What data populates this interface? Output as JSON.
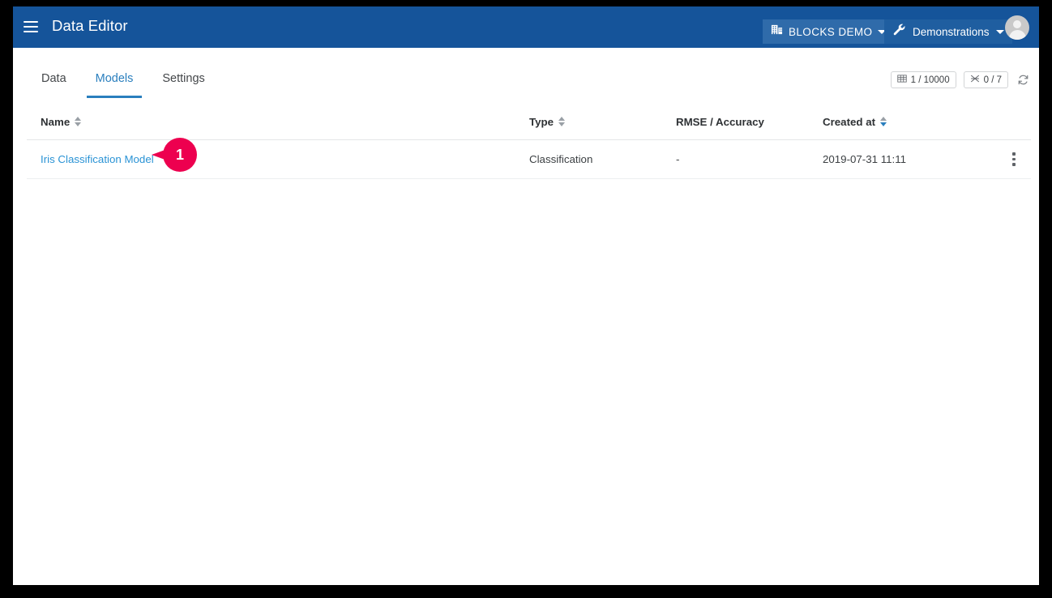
{
  "appbar": {
    "menu_icon": "hamburger-menu-icon",
    "title": "Data Editor",
    "breadcrumb": {
      "org": {
        "icon": "building-icon",
        "label": "BLOCKS DEMO",
        "caret": "chevron-down-icon"
      },
      "project": {
        "icon": "wrench-icon",
        "label": "Demonstrations",
        "caret": "chevron-down-icon"
      }
    },
    "avatar": "user-avatar",
    "background_color": "#15549A"
  },
  "tabs": [
    {
      "label": "Data",
      "active": false
    },
    {
      "label": "Models",
      "active": true
    },
    {
      "label": "Settings",
      "active": false
    }
  ],
  "counters": {
    "rows": {
      "icon": "table-grid-icon",
      "value": "1 / 10000"
    },
    "columns": {
      "icon": "columns-icon",
      "value": "0 / 7"
    },
    "refresh": {
      "icon": "refresh-icon"
    }
  },
  "table": {
    "columns": [
      {
        "key": "name",
        "label": "Name",
        "sortable": true,
        "sort_state": "none"
      },
      {
        "key": "type",
        "label": "Type",
        "sortable": true,
        "sort_state": "none"
      },
      {
        "key": "rmse",
        "label": "RMSE / Accuracy",
        "sortable": false,
        "sort_state": "none"
      },
      {
        "key": "created",
        "label": "Created at",
        "sortable": true,
        "sort_state": "desc"
      }
    ],
    "rows": [
      {
        "name": "Iris Classification Model",
        "type": "Classification",
        "rmse": "-",
        "created": "2019-07-31 11:11",
        "actions": "row-menu-icon"
      }
    ]
  },
  "annotation": {
    "step": "1",
    "color": "#ED004F",
    "targets": "models-table-name-link"
  },
  "colors": {
    "header_blue": "#15549A",
    "accent_blue": "#2A7FBE",
    "link_blue": "#2A93D5",
    "marker_pink": "#ED004F"
  }
}
